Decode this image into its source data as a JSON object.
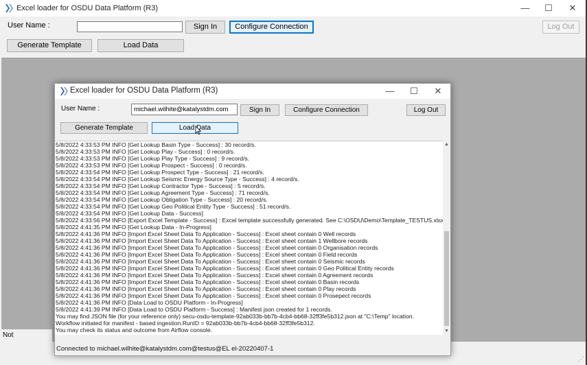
{
  "background_window": {
    "title": "Excel loader for OSDU Data Platform (R3)",
    "user_name_label": "User Name :",
    "user_name_value": "",
    "sign_in_label": "Sign In",
    "configure_label": "Configure Connection",
    "log_out_label": "Log Out",
    "generate_template_label": "Generate Template",
    "load_data_label": "Load Data",
    "status_text": "Not connected...",
    "minimize_glyph": "—",
    "maximize_glyph": "☐",
    "close_glyph": "✕"
  },
  "dialog": {
    "title": "Excel loader for OSDU Data Platform (R3)",
    "user_name_label": "User Name :",
    "user_name_value": "michael.wilhite@katalystdm.com",
    "sign_in_label": "Sign In",
    "configure_label": "Configure Connection",
    "log_out_label": "Log Out",
    "generate_template_label": "Generate Template",
    "load_data_label": "Load Data",
    "minimize_glyph": "—",
    "maximize_glyph": "☐",
    "close_glyph": "✕",
    "status_text": "Connected to michael.wilhite@katalystdm.com@testus@EL el-20220407-1",
    "log_lines": [
      "5/8/2022 4:33:53 PM INFO [Get Lookup Basin Type - Success] : 30 record/s.",
      "5/8/2022 4:33:53 PM INFO [Get Lookup Play - Success] : 0 record/s.",
      "5/8/2022 4:33:53 PM INFO [Get Lookup Play Type - Success] : 9 record/s.",
      "5/8/2022 4:33:53 PM INFO [Get Lookup Prospect - Success] : 0 record/s.",
      "5/8/2022 4:33:54 PM INFO [Get Lookup Prospect Type - Success] : 21 record/s.",
      "5/8/2022 4:33:54 PM INFO [Get Lookup Seismic Energy Source Type - Success] : 4 record/s.",
      "5/8/2022 4:33:54 PM INFO [Get Lookup Contractor Type - Success] : 5 record/s.",
      "5/8/2022 4:33:54 PM INFO [Get Lookup Agreement Type - Success] : 71 record/s.",
      "5/8/2022 4:33:54 PM INFO [Get Lookup Obligation Type - Success] : 20 record/s.",
      "5/8/2022 4:33:54 PM INFO [Get Lookup Geo Political Entity Type - Success] : 51 record/s.",
      "5/8/2022 4:33:54 PM INFO [Get Lookup Data - Success]",
      "5/8/2022 4:33:56 PM INFO [Export Excel Template - Success] : Excel template successfully generated. See C:\\OSDU\\Demo\\Template_TESTUS.xlsx",
      "5/8/2022 4:41:35 PM INFO [Get Lookup Data - In-Progress]",
      "5/8/2022 4:41:36 PM INFO [Import Excel Sheet Data To Application - Success] : Excel sheet contain 0 Well records",
      "5/8/2022 4:41:36 PM INFO [Import Excel Sheet Data To Application - Success] : Excel sheet contain 1 Wellbore records",
      "5/8/2022 4:41:36 PM INFO [Import Excel Sheet Data To Application - Success] : Excel sheet contain 0 Organisation records",
      "5/8/2022 4:41:36 PM INFO [Import Excel Sheet Data To Application - Success] : Excel sheet contain 0 Field records",
      "5/8/2022 4:41:36 PM INFO [Import Excel Sheet Data To Application - Success] : Excel sheet contain 0 Seismic records",
      "5/8/2022 4:41:36 PM INFO [Import Excel Sheet Data To Application - Success] : Excel sheet contain 0 Geo Political Entity records",
      "5/8/2022 4:41:36 PM INFO [Import Excel Sheet Data To Application - Success] : Excel sheet contain 0 Agreement records",
      "5/8/2022 4:41:36 PM INFO [Import Excel Sheet Data To Application - Success] : Excel sheet contain 0 Basin records",
      "5/8/2022 4:41:36 PM INFO [Import Excel Sheet Data To Application - Success] : Excel sheet contain 0 Play records",
      "5/8/2022 4:41:36 PM INFO [Import Excel Sheet Data To Application - Success] : Excel sheet contain 0 Prosepect records",
      "5/8/2022 4:41:36 PM INFO [Data Load to OSDU Platform - In-Progress]",
      "5/8/2022 4:41:39 PM INFO [Data Load to OSDU Platform - Success] : Manifest json created for 1 records.",
      "You may find JSON file (for your reference only) secu-osdu-template-92ab033b-bb7b-4cb4-bb68-32ff3fe5b312.json at \"C:\\Temp\" location.",
      "Workflow initiated for manifest - based ingestion.RunID = 92ab033b-bb7b-4cb4-bb68-32ff3fe5b312.",
      "You may check its status and outcome from Airflow console."
    ]
  },
  "icons": {
    "app_logo": "katalyst-logo-icon",
    "cursor": "mouse-pointer-icon",
    "scroll_up": "scroll-up-arrow-icon",
    "scroll_down": "scroll-down-arrow-icon"
  },
  "colors": {
    "focus_blue": "#0078d7",
    "logo_blue": "#1f5fbf",
    "window_bg": "#f0f0f0",
    "work_area": "#ababab"
  }
}
